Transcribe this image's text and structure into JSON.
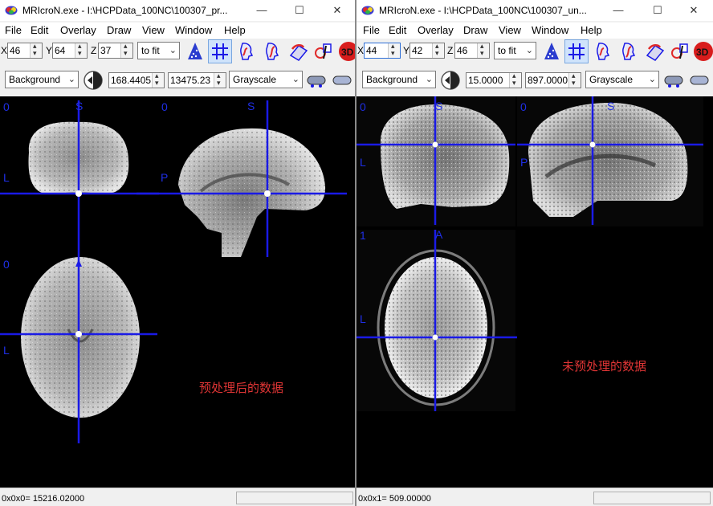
{
  "left": {
    "title": "MRIcroN.exe - I:\\HCPData_100NC\\100307_pr...",
    "window_controls": {
      "minimize": "—",
      "maximize": "☐",
      "close": "✕"
    },
    "menu": [
      "File",
      "Edit",
      "Overlay",
      "Draw",
      "View",
      "Window",
      "Help"
    ],
    "coords": {
      "x_label": "X",
      "x": "46",
      "y_label": "Y",
      "y": "64",
      "z_label": "Z",
      "z": "37"
    },
    "zoom": "to fit",
    "layer": "Background",
    "min_value": "168.4405",
    "max_value": "13475.23",
    "colormap": "Grayscale",
    "orient_labels": {
      "s1": "S",
      "s2": "S",
      "l1": "L",
      "p": "P",
      "l2": "L",
      "zero1": "0",
      "zero2": "0",
      "zero3": "0"
    },
    "caption": "预处理后的数据",
    "status": "0x0x0= 15216.02000"
  },
  "right": {
    "title": "MRIcroN.exe - I:\\HCPData_100NC\\100307_un...",
    "window_controls": {
      "minimize": "—",
      "maximize": "☐",
      "close": "✕"
    },
    "menu": [
      "File",
      "Edit",
      "Overlay",
      "Draw",
      "View",
      "Window",
      "Help"
    ],
    "coords": {
      "x_label": "X",
      "x": "44",
      "y_label": "Y",
      "y": "42",
      "z_label": "Z",
      "z": "46"
    },
    "zoom": "to fit",
    "layer": "Background",
    "min_value": "15.0000",
    "max_value": "897.0000",
    "colormap": "Grayscale",
    "orient_labels": {
      "s1": "S",
      "s2": "S",
      "l1": "L",
      "p": "P",
      "a": "A",
      "l2": "L",
      "zero1": "0",
      "zero2": "0",
      "one": "1"
    },
    "caption": "未预处理的数据",
    "status": "0x0x1= 509.00000"
  },
  "icon_names": [
    "app-logo-icon",
    "render-cone-icon",
    "crosshair-grid-icon",
    "head-profile-icon",
    "head-roi-icon",
    "brain-slice-icon",
    "pen-tool-icon",
    "3d-render-icon",
    "back-arrow-icon",
    "brightness-icon"
  ],
  "colors": {
    "crosshair": "#1a1ae6",
    "orient_text": "#1f2fe6",
    "caption": "#e03535",
    "viewport_bg": "#000000"
  }
}
